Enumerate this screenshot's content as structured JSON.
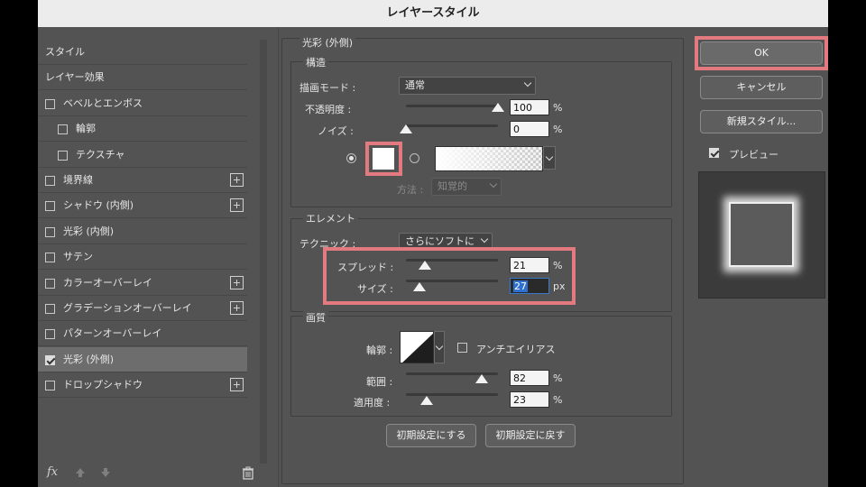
{
  "window": {
    "title": "レイヤースタイル"
  },
  "style_list": {
    "items": [
      {
        "label": "スタイル",
        "has_checkbox": false,
        "checked": false,
        "has_plus": false,
        "selected": false
      },
      {
        "label": "レイヤー効果",
        "has_checkbox": false,
        "checked": false,
        "has_plus": false,
        "selected": false
      },
      {
        "label": "ベベルとエンボス",
        "has_checkbox": true,
        "checked": false,
        "has_plus": false,
        "selected": false
      },
      {
        "label": "輪郭",
        "has_checkbox": true,
        "checked": false,
        "has_plus": false,
        "selected": false,
        "indent": true
      },
      {
        "label": "テクスチャ",
        "has_checkbox": true,
        "checked": false,
        "has_plus": false,
        "selected": false,
        "indent": true
      },
      {
        "label": "境界線",
        "has_checkbox": true,
        "checked": false,
        "has_plus": true,
        "selected": false
      },
      {
        "label": "シャドウ (内側)",
        "has_checkbox": true,
        "checked": false,
        "has_plus": true,
        "selected": false
      },
      {
        "label": "光彩 (内側)",
        "has_checkbox": true,
        "checked": false,
        "has_plus": false,
        "selected": false
      },
      {
        "label": "サテン",
        "has_checkbox": true,
        "checked": false,
        "has_plus": false,
        "selected": false
      },
      {
        "label": "カラーオーバーレイ",
        "has_checkbox": true,
        "checked": false,
        "has_plus": true,
        "selected": false
      },
      {
        "label": "グラデーションオーバーレイ",
        "has_checkbox": true,
        "checked": false,
        "has_plus": true,
        "selected": false
      },
      {
        "label": "パターンオーバーレイ",
        "has_checkbox": true,
        "checked": false,
        "has_plus": false,
        "selected": false
      },
      {
        "label": "光彩 (外側)",
        "has_checkbox": true,
        "checked": true,
        "has_plus": false,
        "selected": true
      },
      {
        "label": "ドロップシャドウ",
        "has_checkbox": true,
        "checked": false,
        "has_plus": true,
        "selected": false
      }
    ],
    "footer": {
      "fx_label": "fx",
      "icons": [
        "fx-icon",
        "arrow-up-icon",
        "arrow-down-icon",
        "trash-icon"
      ]
    }
  },
  "outer_glow": {
    "title": "光彩 (外側)",
    "structure": {
      "legend": "構造",
      "blend_mode_label": "描画モード :",
      "blend_mode_value": "通常",
      "opacity_label": "不透明度 :",
      "opacity_value": "100",
      "opacity_unit": "%",
      "opacity_fraction": 1.0,
      "noise_label": "ノイズ :",
      "noise_value": "0",
      "noise_unit": "%",
      "noise_fraction": 0.0,
      "color_mode": "solid",
      "glow_color": "#ffffff",
      "method_label": "方法 :",
      "method_value": "知覚的"
    },
    "elements": {
      "legend": "エレメント",
      "technique_label": "テクニック :",
      "technique_value": "さらにソフトに",
      "spread_label": "スプレッド :",
      "spread_value": "21",
      "spread_unit": "%",
      "spread_fraction": 0.21,
      "size_label": "サイズ :",
      "size_value": "27",
      "size_unit": "px",
      "size_fraction": 0.15
    },
    "quality": {
      "legend": "画質",
      "contour_label": "輪郭 :",
      "antialias_label": "アンチエイリアス",
      "antialias_checked": false,
      "range_label": "範囲 :",
      "range_value": "82",
      "range_unit": "%",
      "range_fraction": 0.82,
      "jitter_label": "適用度 :",
      "jitter_value": "23",
      "jitter_unit": "%",
      "jitter_fraction": 0.23
    },
    "buttons": {
      "make_default": "初期設定にする",
      "reset_default": "初期設定に戻す"
    }
  },
  "actions": {
    "ok": "OK",
    "cancel": "キャンセル",
    "new_style": "新規スタイル...",
    "preview_label": "プレビュー",
    "preview_checked": true
  },
  "colors": {
    "highlight": "#e27a80",
    "panel": "#535353",
    "selected_row": "#6d6d6d",
    "glow": "#ffffff"
  }
}
